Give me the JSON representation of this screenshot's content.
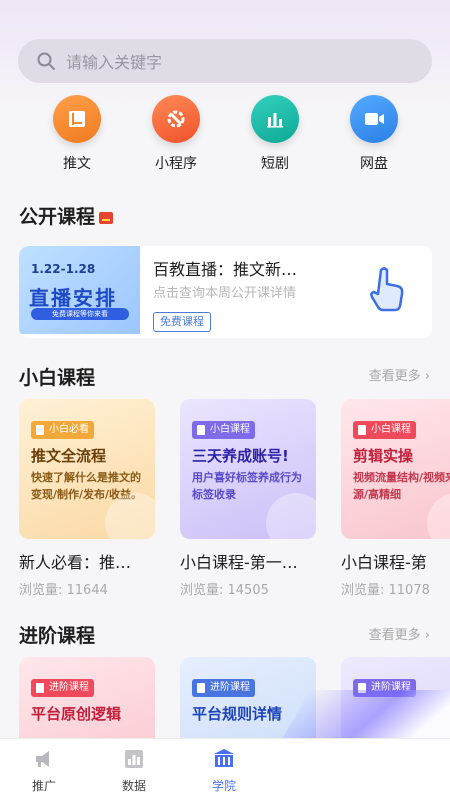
{
  "search": {
    "placeholder": "请输入关键字"
  },
  "quick_links": [
    {
      "label": "推文",
      "icon": "book-icon",
      "color": "#f5862b"
    },
    {
      "label": "小程序",
      "icon": "wrench-gear-icon",
      "color": "#f5652b"
    },
    {
      "label": "短剧",
      "icon": "bar-chart-icon",
      "color": "#16b9a6"
    },
    {
      "label": "网盘",
      "icon": "video-camera-icon",
      "color": "#2f8ff0"
    }
  ],
  "public_courses": {
    "title": "公开课程",
    "card": {
      "thumb_date": "1.22-1.28",
      "thumb_title": "直播安排",
      "thumb_strip": "免费课程等你来看",
      "title": "百教直播：推文新…",
      "subtitle": "点击查询本周公开课详情",
      "button": "免费课程"
    }
  },
  "beginner": {
    "title": "小白课程",
    "more": "查看更多",
    "cards": [
      {
        "tag": "小白必看",
        "title": "推文全流程",
        "desc": "快速了解什么是推文的变现/制作/发布/收益。",
        "name": "新人必看：推…",
        "views": "浏览量: 11644",
        "bg": "#fde9c6",
        "tag_bg": "#f2a93a",
        "text": "#7a4a0a"
      },
      {
        "tag": "小白课程",
        "title": "三天养成账号!",
        "desc": "用户喜好标签养成行为标签收录",
        "name": "小白课程-第一…",
        "views": "浏览量: 14505",
        "bg": "#ddd6fb",
        "tag_bg": "#7f6bea",
        "text": "#3a2ab0"
      },
      {
        "tag": "小白课程",
        "title": "剪辑实操",
        "desc": "视频流量结构/视频来源/高精细",
        "name": "小白课程-第",
        "views": "浏览量: 11078",
        "bg": "#fcdde3",
        "tag_bg": "#ee4a5c",
        "text": "#c21f3a"
      }
    ]
  },
  "advanced": {
    "title": "进阶课程",
    "more": "查看更多",
    "cards": [
      {
        "tag": "进阶课程",
        "title": "平台原创逻辑",
        "bg": "#fcdde3",
        "tag_bg": "#ee4a5c",
        "text": "#c21f3a"
      },
      {
        "tag": "进阶课程",
        "title": "平台规则详情",
        "bg": "#d8e4fb",
        "tag_bg": "#4a74e0",
        "text": "#1f44b8"
      },
      {
        "tag": "进阶课程",
        "title": "",
        "bg": "#e2ddfb",
        "tag_bg": "#7f6bea",
        "text": "#3a2ab0"
      }
    ]
  },
  "nav": [
    {
      "label": "推广",
      "icon": "megaphone-icon",
      "active": false
    },
    {
      "label": "数据",
      "icon": "chart-icon",
      "active": false
    },
    {
      "label": "学院",
      "icon": "academy-icon",
      "active": true
    }
  ]
}
